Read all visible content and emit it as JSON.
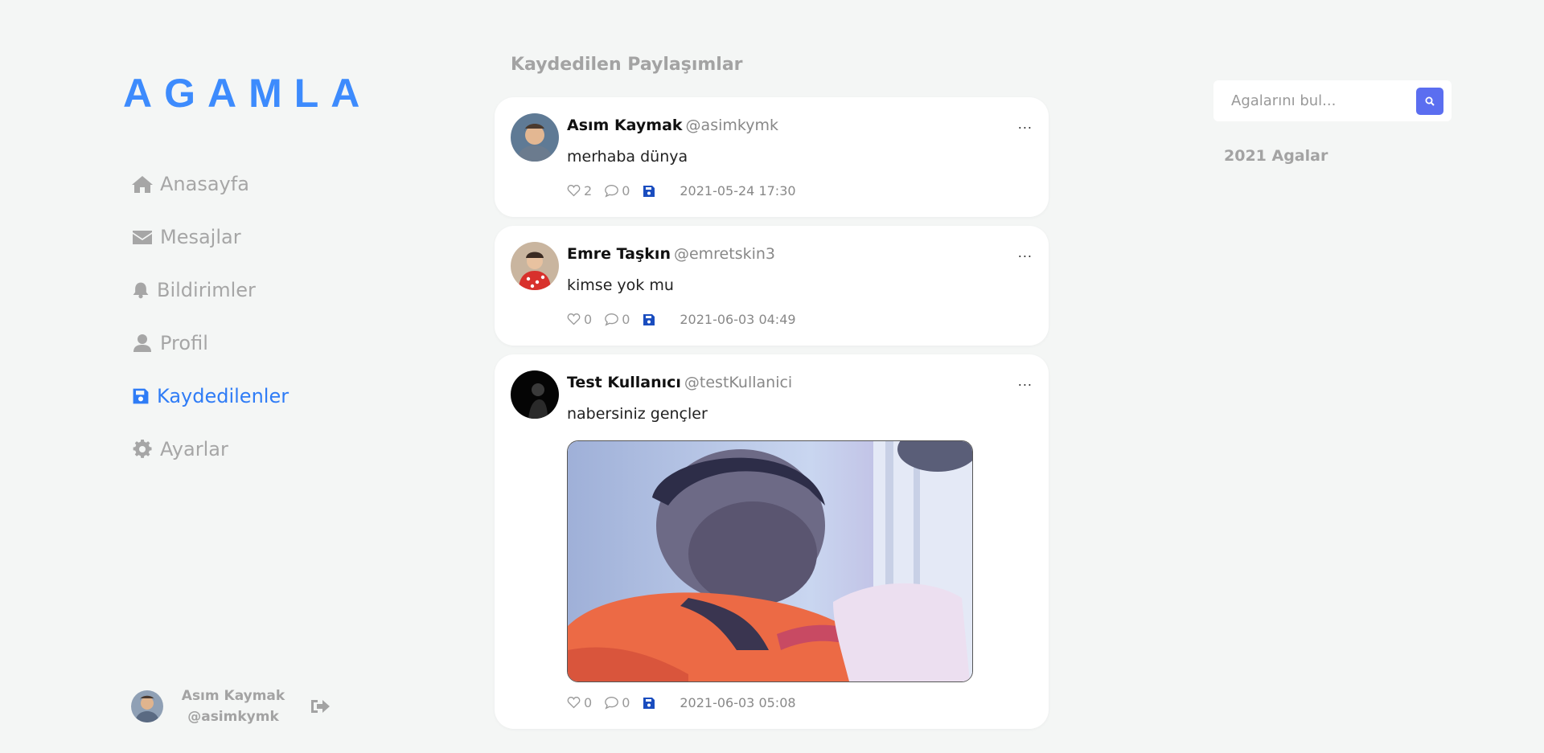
{
  "brand": {
    "logo": "AGAMLA",
    "accent": "#2f7cf6"
  },
  "nav": [
    {
      "label": "Anasayfa",
      "icon": "home-icon"
    },
    {
      "label": "Mesajlar",
      "icon": "envelope-icon"
    },
    {
      "label": "Bildirimler",
      "icon": "bell-icon"
    },
    {
      "label": "Profil",
      "icon": "user-icon"
    },
    {
      "label": "Kaydedilenler",
      "icon": "save-icon",
      "active": true
    },
    {
      "label": "Ayarlar",
      "icon": "gear-icon"
    }
  ],
  "current_user": {
    "name": "Asım Kaymak",
    "handle": "@asimkymk"
  },
  "feed": {
    "title": "Kaydedilen Paylaşımlar",
    "posts": [
      {
        "name": "Asım Kaymak",
        "handle": "@asimkymk",
        "text": "merhaba dünya",
        "likes": "2",
        "comments": "0",
        "date": "2021-05-24 17:30",
        "more": "..."
      },
      {
        "name": "Emre Taşkın",
        "handle": "@emretskin3",
        "text": "kimse yok mu",
        "likes": "0",
        "comments": "0",
        "date": "2021-06-03 04:49",
        "more": "..."
      },
      {
        "name": "Test Kullanıcı",
        "handle": "@testKullanici",
        "text": "nabersiniz gençler",
        "likes": "0",
        "comments": "0",
        "date": "2021-06-03 05:08",
        "more": "...",
        "has_image": true
      }
    ]
  },
  "search": {
    "placeholder": "Agalarını bul..."
  },
  "right": {
    "title": "2021 Agalar"
  }
}
